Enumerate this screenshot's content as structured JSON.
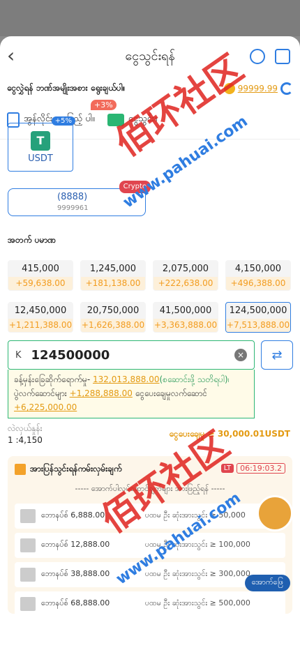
{
  "header": {
    "title": "ငွေသွင်းရန်"
  },
  "top": {
    "label": "ငွေလွှဲရန် ဘဏ်အမျိုးအစား ရွေးချယ်ပါ။",
    "balance": "99999.99"
  },
  "methods": [
    {
      "label": "အွန်လိုင်းအားဖြည့် ပါ။",
      "badge": "+3%"
    },
    {
      "label": "ငွေသွင်း။",
      "badge": ""
    }
  ],
  "usdt": {
    "label": "USDT",
    "badge": "+5%",
    "logo": "T"
  },
  "crypto": {
    "line1": "(8888)",
    "line2": "9999961",
    "tag": "Crypto"
  },
  "section_label": "အတက် ပမာဏ",
  "amounts": [
    {
      "value": "415,000",
      "bonus": "+59,638.00"
    },
    {
      "value": "1,245,000",
      "bonus": "+181,138.00"
    },
    {
      "value": "2,075,000",
      "bonus": "+222,638.00"
    },
    {
      "value": "4,150,000",
      "bonus": "+496,388.00"
    },
    {
      "value": "12,450,000",
      "bonus": "+1,211,388.00"
    },
    {
      "value": "20,750,000",
      "bonus": "+1,626,388.00"
    },
    {
      "value": "41,500,000",
      "bonus": "+3,363,888.00"
    },
    {
      "value": "124,500,000",
      "bonus": "+7,513,888.00"
    }
  ],
  "input": {
    "currency": "K",
    "value": "124500000"
  },
  "info": {
    "line1_prefix": "ခန့်မှန်းခြေဆိုက်ရောက်မှု-",
    "line1_value": "132,013,888.00",
    "line1_suffix": "(စဆောင်းဖို့ သတိရပါ)၊",
    "line2_prefix": "ပွဲလက်ဆောင်များ",
    "line2_value": "+1,288,888.00",
    "line2_suffix": "ငွေပေးချေမှုလက်ဆောင်",
    "line3_value": "+6,225,000.00"
  },
  "rate": {
    "label": "လဲလှယ်နှုန်း",
    "value": "1 :4,150"
  },
  "minimum": "ငွေပေးချေမှု ≥ 30,000.01USDT",
  "promo": {
    "title": "အားပြန်သွင်းရန်ကမ်းလှမ်းချက်",
    "lt": "LT",
    "timer": "06:19:03.2",
    "desc": "----- အောက်ပါလုပ်ဆောင်ချက်များ အားဖြည့်ရန် -----",
    "items": [
      {
        "name": "ဘောနပ်စ် 6,888.00",
        "cond": "ပထမ ဦး ဆုံးအားသွင်း ≥ 50,000"
      },
      {
        "name": "ဘောနပ်စ် 12,888.00",
        "cond": "ပထမ ဦး ဆုံးအားသွင်း ≥ 100,000"
      },
      {
        "name": "ဘောနပ်စ် 38,888.00",
        "cond": "ပထမ ဦး ဆုံးအားသွင်း ≥ 300,000"
      },
      {
        "name": "ဘောနပ်စ် 68,888.00",
        "cond": "ပထမ ဦး ဆုံးအားသွင်း ≥ 500,000"
      }
    ]
  },
  "float_button": "အောက်ဖြေ",
  "watermark": {
    "text": "佰环社区",
    "site": "www.pahuai.com"
  }
}
